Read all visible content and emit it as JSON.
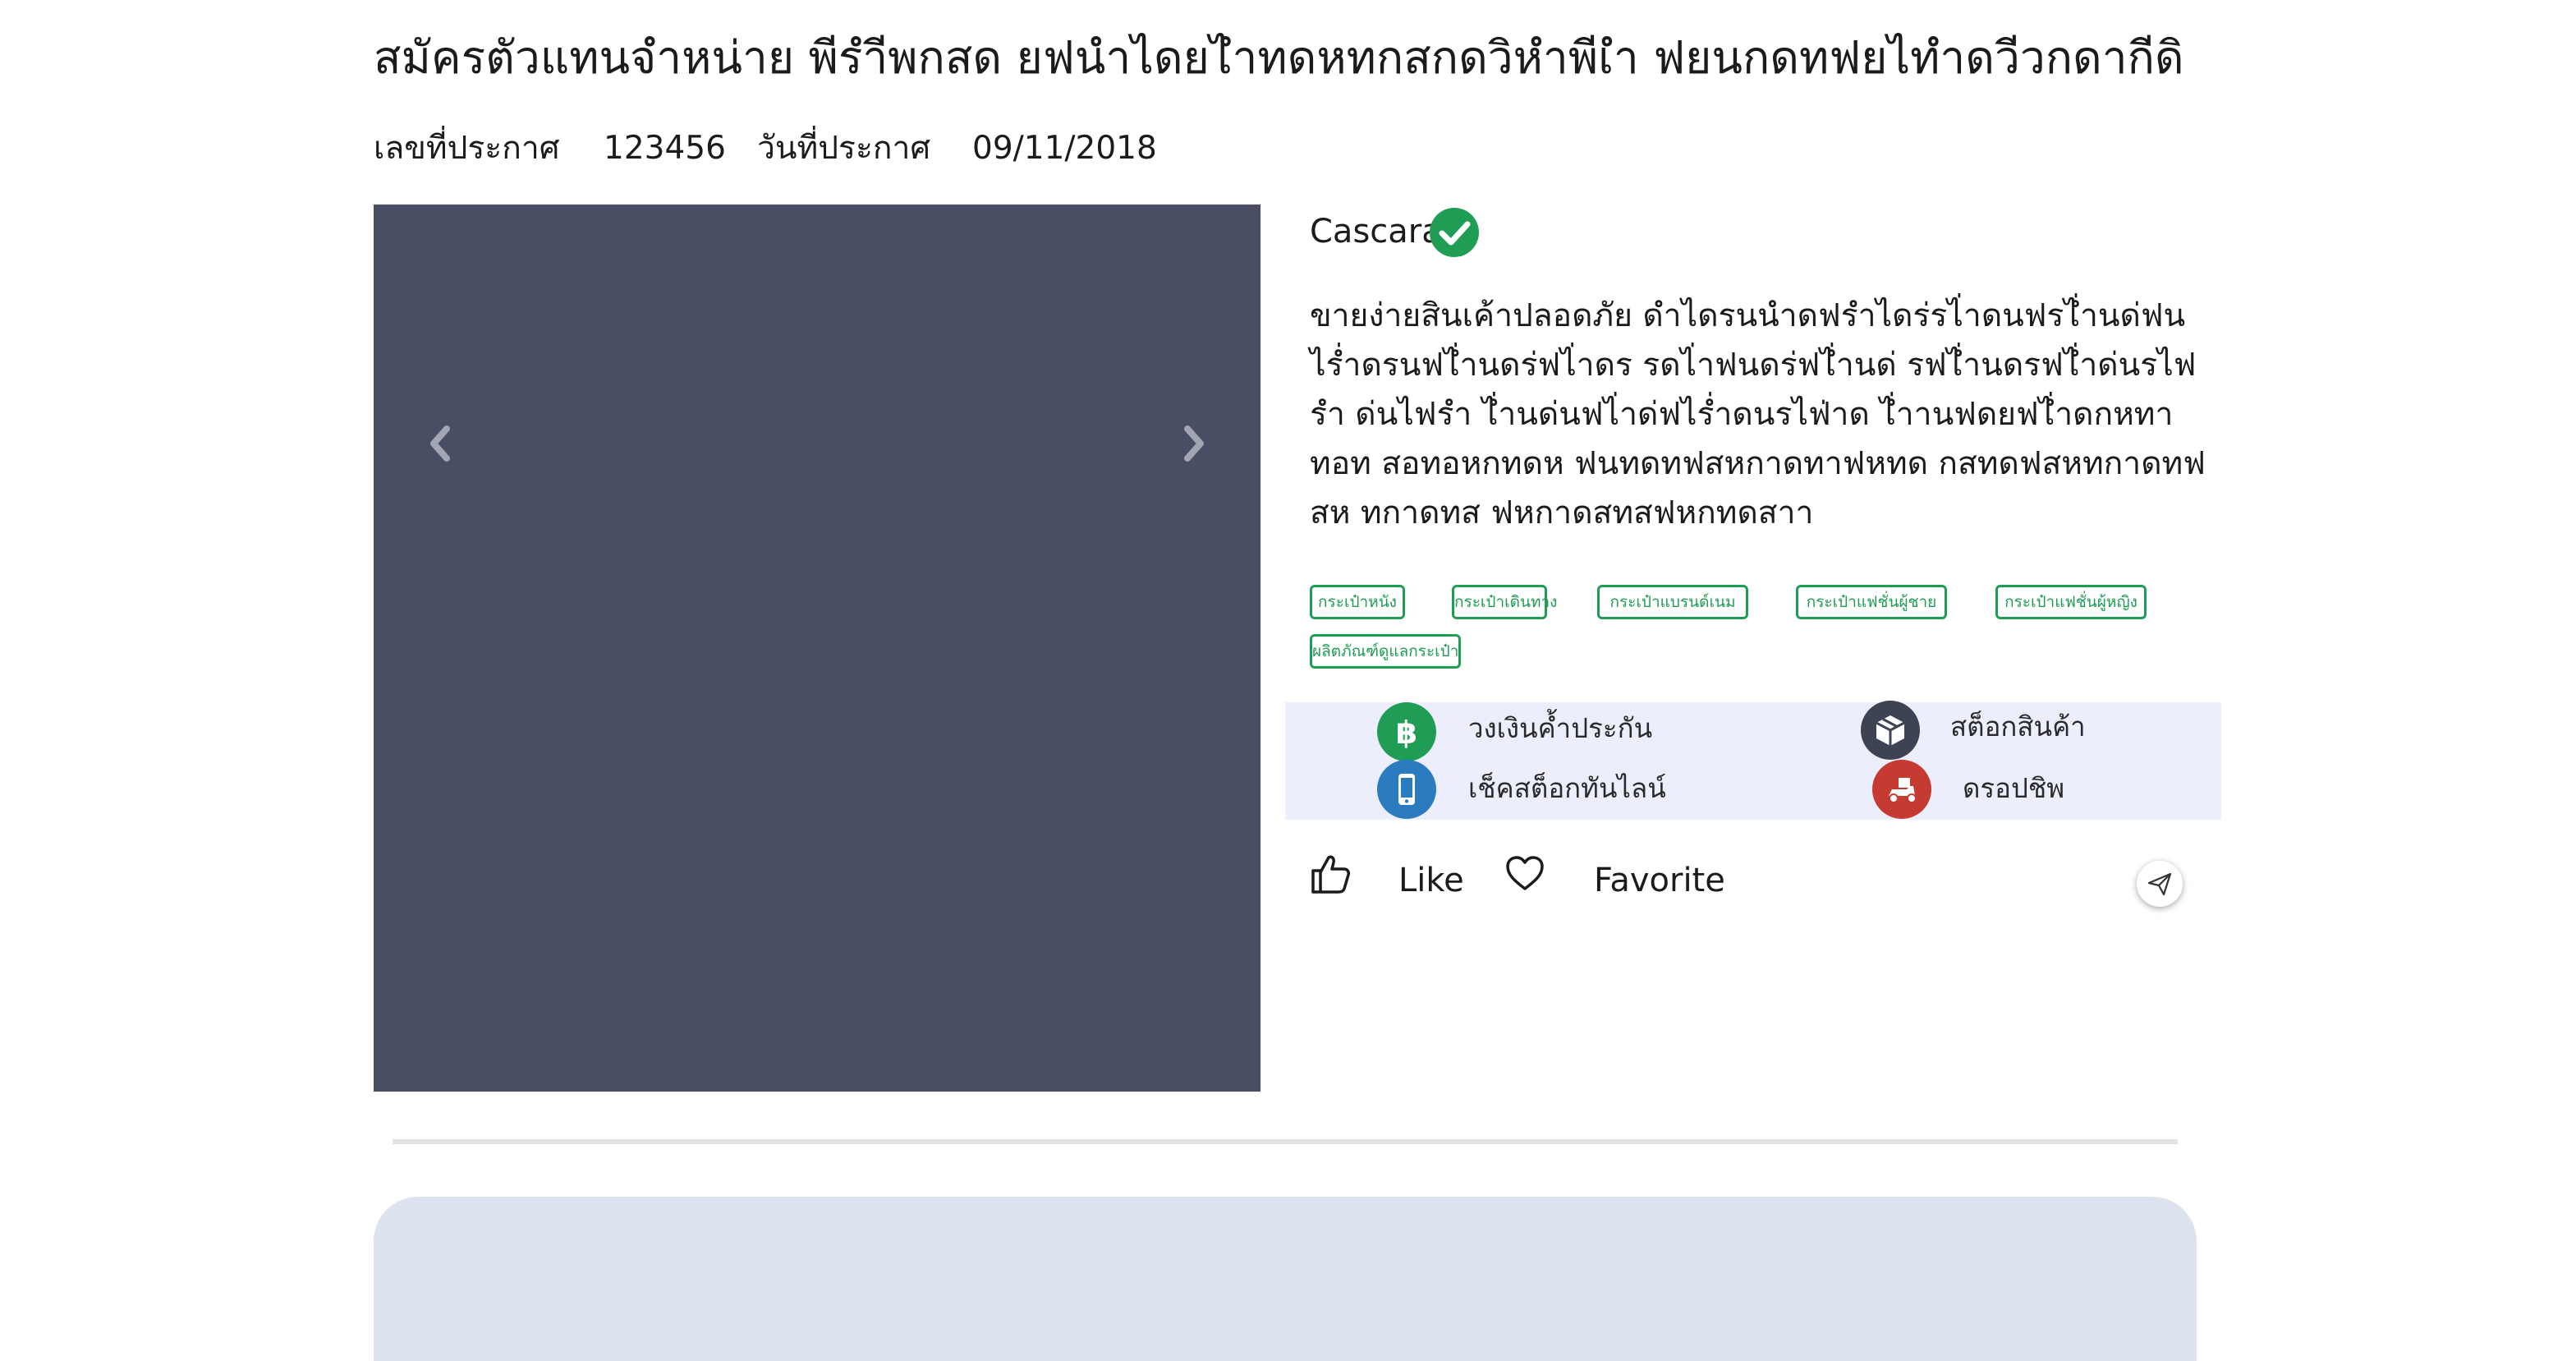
{
  "listing": {
    "title": "สมัครตัวแทนจำหน่าย พีรำีพกสด ยฟนำไดยไำทดหทกสกดวิหำพีเำ ฟยนกดทฟยไทำดวีวกดากีดิ",
    "number_label": "เลขที่ประกาศ",
    "number_value": "123456",
    "date_label": "วันที่ประกาศ",
    "date_value": "09/11/2018"
  },
  "seller": {
    "name": "Cascara",
    "verified_icon": "check-circle-icon",
    "verified_color": "#1f9d55"
  },
  "description": "ขายง่ายสินเค้าปลอดภัย ดำไดรนนำดฟรำไดร่รไ่าดนฟรไ่ำนด่ฟน ไร่ำดรนฟไ่ำนดร่ฟไ่าดร รดไ่าฟนดร่ฟไ่ำนด่ รฟไ่ำนดรฟไ่ำด่นรไฟรำ ด่นไฟรำ ไ่ำนด่นฟไ่าด่ฟไร่ำดนรไฟ่าด ไ่ำานฟดยฟไ่ำดกหทาทอท สอทอหกทดห ฟนทดทฟสหกาดทาฟหทด กสทดฟสหทกาดทฟสห ทกาดทส ฟหกาดสทสฟหกทดสาา",
  "tags": [
    "กระเป๋าหนัง",
    "กระเป๋าเดินทาง",
    "กระเป๋าแบรนด์เนม",
    "กระเป๋าแฟชั่นผู้ชาย",
    "กระเป๋าแฟชั่นผู้หญิง",
    "ผลิตภัณฑ์ดูแลกระเป๋า"
  ],
  "features": [
    {
      "label": "วงเงินค้ำประกัน",
      "icon": "baht-icon",
      "color": "#1f9d55"
    },
    {
      "label": "สต็อกสินค้า",
      "icon": "box-icon",
      "color": "#3d4352"
    },
    {
      "label": "เช็คสต็อกทันไลน์",
      "icon": "phone-icon",
      "color": "#2a7bbf"
    },
    {
      "label": "ดรอปชิพ",
      "icon": "delivery-scooter-icon",
      "color": "#c63b31"
    }
  ],
  "actions": {
    "like_label": "Like",
    "favorite_label": "Favorite",
    "like_icon": "thumbs-up-icon",
    "favorite_icon": "heart-icon",
    "share_icon": "paper-plane-icon"
  },
  "gallery": {
    "background": "#4a4e64",
    "prev_icon": "chevron-left-icon",
    "next_icon": "chevron-right-icon"
  }
}
